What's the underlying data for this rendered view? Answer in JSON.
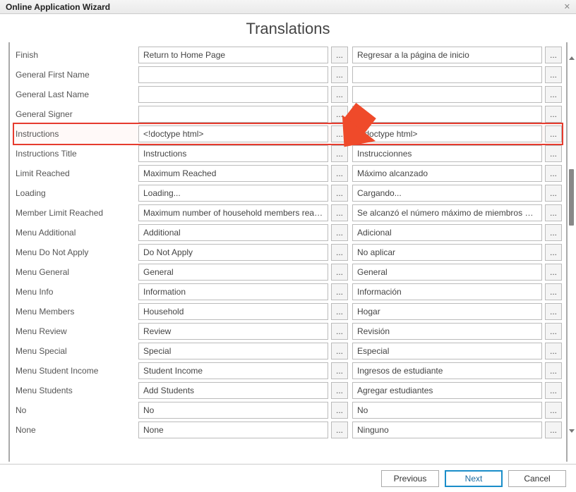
{
  "window": {
    "title": "Online Application Wizard",
    "close": "✕"
  },
  "heading": "Translations",
  "rows": [
    {
      "label": "Finish",
      "col1": "Return to Home Page",
      "col2": "Regresar a la página de inicio",
      "highlight": false
    },
    {
      "label": "General First Name",
      "col1": "",
      "col2": "",
      "highlight": false
    },
    {
      "label": "General Last Name",
      "col1": "",
      "col2": "",
      "highlight": false
    },
    {
      "label": "General Signer",
      "col1": "",
      "col2": "",
      "highlight": false
    },
    {
      "label": "Instructions",
      "col1": "<!doctype html>",
      "col2": "<!doctype html>",
      "highlight": true
    },
    {
      "label": "Instructions Title",
      "col1": "Instructions",
      "col2": "Instruccionnes",
      "highlight": false
    },
    {
      "label": "Limit Reached",
      "col1": "Maximum Reached",
      "col2": "Máximo alcanzado",
      "highlight": false
    },
    {
      "label": "Loading",
      "col1": "Loading...",
      "col2": "Cargando...",
      "highlight": false
    },
    {
      "label": "Member Limit Reached",
      "col1": "Maximum number of household members reached",
      "col2": "Se alcanzó el número máximo de miembros del hogar",
      "highlight": false
    },
    {
      "label": "Menu Additional",
      "col1": "Additional",
      "col2": "Adicional",
      "highlight": false
    },
    {
      "label": "Menu Do Not Apply",
      "col1": "Do Not Apply",
      "col2": "No aplicar",
      "highlight": false
    },
    {
      "label": "Menu General",
      "col1": "General",
      "col2": "General",
      "highlight": false
    },
    {
      "label": "Menu Info",
      "col1": "Information",
      "col2": "Información",
      "highlight": false
    },
    {
      "label": "Menu Members",
      "col1": "Household",
      "col2": "Hogar",
      "highlight": false
    },
    {
      "label": "Menu Review",
      "col1": "Review",
      "col2": "Revisión",
      "highlight": false
    },
    {
      "label": "Menu Special",
      "col1": "Special",
      "col2": "Especial",
      "highlight": false
    },
    {
      "label": "Menu Student Income",
      "col1": "Student Income",
      "col2": "Ingresos de estudiante",
      "highlight": false
    },
    {
      "label": "Menu Students",
      "col1": "Add Students",
      "col2": "Agregar estudiantes",
      "highlight": false
    },
    {
      "label": "No",
      "col1": "No",
      "col2": "No",
      "highlight": false
    },
    {
      "label": "None",
      "col1": "None",
      "col2": "Ninguno",
      "highlight": false
    }
  ],
  "ellipsis": "...",
  "footer": {
    "previous": "Previous",
    "next": "Next",
    "cancel": "Cancel"
  }
}
